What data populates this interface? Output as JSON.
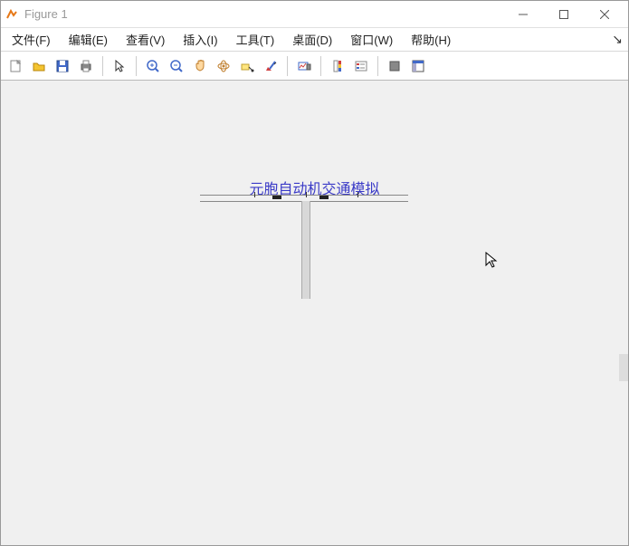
{
  "window": {
    "title": "Figure 1"
  },
  "menu": {
    "file": "文件(F)",
    "edit": "编辑(E)",
    "view": "查看(V)",
    "insert": "插入(I)",
    "tools": "工具(T)",
    "desktop": "桌面(D)",
    "window": "窗口(W)",
    "help": "帮助(H)"
  },
  "figure": {
    "title": "元胞自动机交通模拟"
  },
  "icons": {
    "new": "new-file",
    "open": "open-folder",
    "save": "save",
    "print": "print",
    "pointer": "pointer",
    "zoomin": "zoom-in",
    "zoomout": "zoom-out",
    "pan": "pan-hand",
    "rotate": "rotate-3d",
    "datacursor": "data-cursor",
    "brush": "brush",
    "link": "link-plots",
    "colorbar": "colorbar",
    "legend": "legend",
    "hide": "hide-tools",
    "dock": "dock-figure"
  }
}
